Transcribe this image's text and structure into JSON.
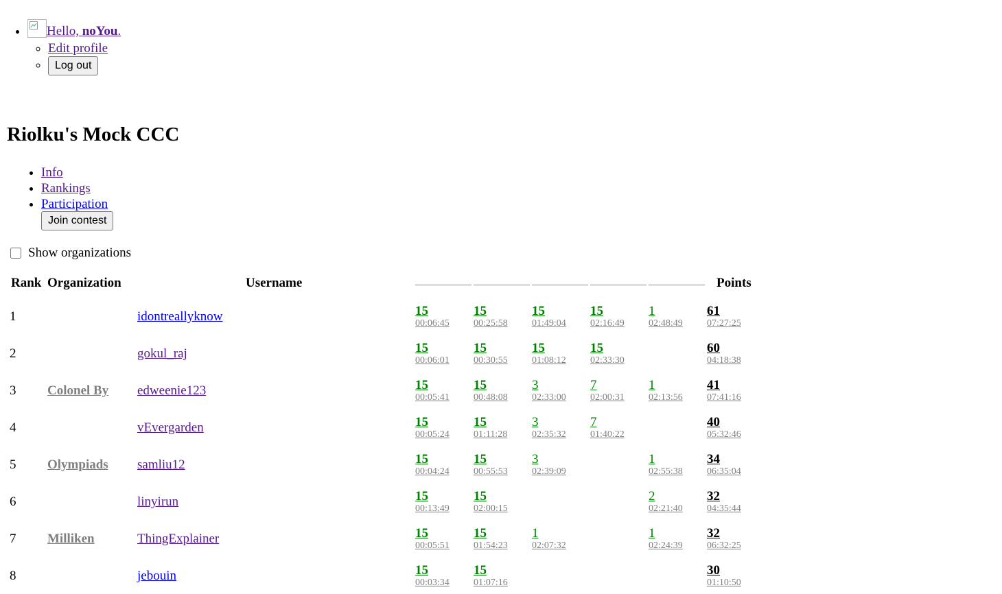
{
  "user_menu": {
    "greeting_prefix": "Hello, ",
    "username": "noYou",
    "greeting_suffix": ".",
    "edit_profile": "Edit profile",
    "logout": "Log out"
  },
  "contest": {
    "title": "Riolku's Mock CCC",
    "nav": [
      "Info",
      "Rankings",
      "Participation"
    ],
    "join_button": "Join contest",
    "show_organizations": "Show organizations"
  },
  "table": {
    "headers": {
      "rank": "Rank",
      "organization": "Organization",
      "username": "Username",
      "points": "Points"
    },
    "problem_count": 5,
    "rows": [
      {
        "rank": "1",
        "organization": "",
        "username": "idontreallyknow",
        "visited": false,
        "problems": [
          {
            "score": "15",
            "time": "00:06:45",
            "full": true
          },
          {
            "score": "15",
            "time": "00:25:58",
            "full": true
          },
          {
            "score": "15",
            "time": "01:49:04",
            "full": true
          },
          {
            "score": "15",
            "time": "02:16:49",
            "full": true
          },
          {
            "score": "1",
            "time": "02:48:49",
            "full": false
          }
        ],
        "points": "61",
        "total_time": "07:27:25"
      },
      {
        "rank": "2",
        "organization": "",
        "username": "gokul_raj",
        "visited": true,
        "problems": [
          {
            "score": "15",
            "time": "00:06:01",
            "full": true
          },
          {
            "score": "15",
            "time": "00:30:55",
            "full": true
          },
          {
            "score": "15",
            "time": "01:08:12",
            "full": true
          },
          {
            "score": "15",
            "time": "02:33:30",
            "full": true
          },
          null
        ],
        "points": "60",
        "total_time": "04:18:38"
      },
      {
        "rank": "3",
        "organization": "Colonel By",
        "username": "edweenie123",
        "visited": true,
        "problems": [
          {
            "score": "15",
            "time": "00:05:41",
            "full": true
          },
          {
            "score": "15",
            "time": "00:48:08",
            "full": true
          },
          {
            "score": "3",
            "time": "02:33:00",
            "full": false
          },
          {
            "score": "7",
            "time": "02:00:31",
            "full": false
          },
          {
            "score": "1",
            "time": "02:13:56",
            "full": false
          }
        ],
        "points": "41",
        "total_time": "07:41:16"
      },
      {
        "rank": "4",
        "organization": "",
        "username": "vEvergarden",
        "visited": true,
        "problems": [
          {
            "score": "15",
            "time": "00:05:24",
            "full": true
          },
          {
            "score": "15",
            "time": "01:11:28",
            "full": true
          },
          {
            "score": "3",
            "time": "02:35:32",
            "full": false
          },
          {
            "score": "7",
            "time": "01:40:22",
            "full": false
          },
          null
        ],
        "points": "40",
        "total_time": "05:32:46"
      },
      {
        "rank": "5",
        "organization": "Olympiads",
        "username": "samliu12",
        "visited": true,
        "problems": [
          {
            "score": "15",
            "time": "00:04:24",
            "full": true
          },
          {
            "score": "15",
            "time": "00:55:53",
            "full": true
          },
          {
            "score": "3",
            "time": "02:39:09",
            "full": false
          },
          null,
          {
            "score": "1",
            "time": "02:55:38",
            "full": false
          }
        ],
        "points": "34",
        "total_time": "06:35:04"
      },
      {
        "rank": "6",
        "organization": "",
        "username": "linyirun",
        "visited": true,
        "problems": [
          {
            "score": "15",
            "time": "00:13:49",
            "full": true
          },
          {
            "score": "15",
            "time": "02:00:15",
            "full": true
          },
          null,
          null,
          {
            "score": "2",
            "time": "02:21:40",
            "full": false
          }
        ],
        "points": "32",
        "total_time": "04:35:44"
      },
      {
        "rank": "7",
        "organization": "Milliken",
        "username": "ThingExplainer",
        "visited": true,
        "problems": [
          {
            "score": "15",
            "time": "00:05:51",
            "full": true
          },
          {
            "score": "15",
            "time": "01:54:23",
            "full": true
          },
          {
            "score": "1",
            "time": "02:07:32",
            "full": false
          },
          null,
          {
            "score": "1",
            "time": "02:24:39",
            "full": false
          }
        ],
        "points": "32",
        "total_time": "06:32:25"
      },
      {
        "rank": "8",
        "organization": "",
        "username": "jebouin",
        "visited": false,
        "problems": [
          {
            "score": "15",
            "time": "00:03:34",
            "full": true
          },
          {
            "score": "15",
            "time": "01:07:16",
            "full": true
          },
          null,
          null,
          null
        ],
        "points": "30",
        "total_time": "01:10:50"
      }
    ]
  }
}
